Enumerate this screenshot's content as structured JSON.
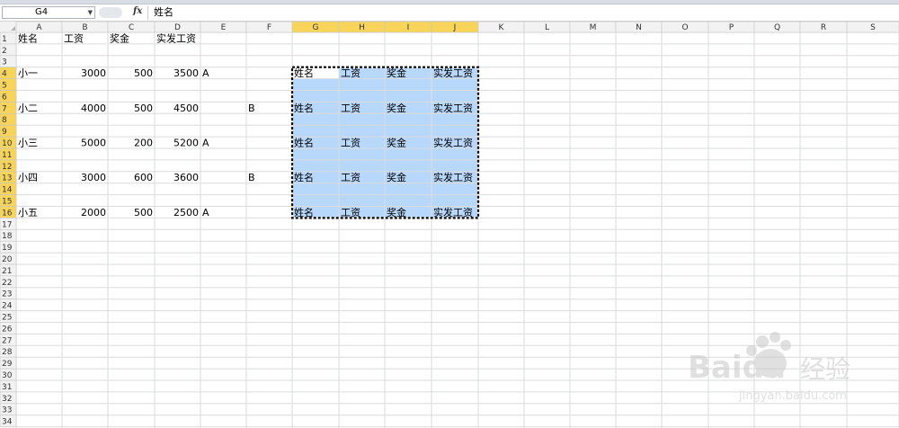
{
  "formula_bar": {
    "name_box": "G4",
    "fx_label": "fx",
    "content": "姓名"
  },
  "sheet": {
    "columns": [
      "A",
      "B",
      "C",
      "D",
      "E",
      "F",
      "G",
      "H",
      "I",
      "J",
      "K",
      "L",
      "M",
      "N",
      "O",
      "P",
      "Q",
      "R",
      "S"
    ],
    "rows": [
      "1",
      "2",
      "3",
      "4",
      "5",
      "6",
      "7",
      "8",
      "9",
      "10",
      "11",
      "12",
      "13",
      "14",
      "15",
      "16",
      "17",
      "18",
      "19",
      "20",
      "21",
      "22",
      "23",
      "24",
      "25",
      "26",
      "27",
      "28",
      "29",
      "30",
      "31",
      "32",
      "33",
      "34"
    ],
    "selected_columns": [
      "G",
      "H",
      "I",
      "J"
    ],
    "selected_rows": [
      "4",
      "5",
      "6",
      "7",
      "8",
      "9",
      "10",
      "11",
      "12",
      "13",
      "14",
      "15",
      "16"
    ],
    "active_cell": "G4",
    "header_color": "#f2f2f2",
    "selected_header_color": "#f8d45a",
    "selection_fill": "#b7d7fb",
    "cells": [
      {
        "ref": "A1",
        "text": "姓名"
      },
      {
        "ref": "B1",
        "text": "工资"
      },
      {
        "ref": "C1",
        "text": "奖金"
      },
      {
        "ref": "D1",
        "text": "实发工资"
      },
      {
        "ref": "A4",
        "text": "小一"
      },
      {
        "ref": "B4",
        "text": "3000"
      },
      {
        "ref": "C4",
        "text": "500"
      },
      {
        "ref": "D4",
        "text": "3500"
      },
      {
        "ref": "E4",
        "text": "A"
      },
      {
        "ref": "G4",
        "text": "姓名"
      },
      {
        "ref": "H4",
        "text": "工资"
      },
      {
        "ref": "I4",
        "text": "奖金"
      },
      {
        "ref": "J4",
        "text": "实发工资"
      },
      {
        "ref": "A7",
        "text": "小二"
      },
      {
        "ref": "B7",
        "text": "4000"
      },
      {
        "ref": "C7",
        "text": "500"
      },
      {
        "ref": "D7",
        "text": "4500"
      },
      {
        "ref": "F7",
        "text": "B"
      },
      {
        "ref": "G7",
        "text": "姓名"
      },
      {
        "ref": "H7",
        "text": "工资"
      },
      {
        "ref": "I7",
        "text": "奖金"
      },
      {
        "ref": "J7",
        "text": "实发工资"
      },
      {
        "ref": "A10",
        "text": "小三"
      },
      {
        "ref": "B10",
        "text": "5000"
      },
      {
        "ref": "C10",
        "text": "200"
      },
      {
        "ref": "D10",
        "text": "5200"
      },
      {
        "ref": "E10",
        "text": "A"
      },
      {
        "ref": "G10",
        "text": "姓名"
      },
      {
        "ref": "H10",
        "text": "工资"
      },
      {
        "ref": "I10",
        "text": "奖金"
      },
      {
        "ref": "J10",
        "text": "实发工资"
      },
      {
        "ref": "A13",
        "text": "小四"
      },
      {
        "ref": "B13",
        "text": "3000"
      },
      {
        "ref": "C13",
        "text": "600"
      },
      {
        "ref": "D13",
        "text": "3600"
      },
      {
        "ref": "F13",
        "text": "B"
      },
      {
        "ref": "G13",
        "text": "姓名"
      },
      {
        "ref": "H13",
        "text": "工资"
      },
      {
        "ref": "I13",
        "text": "奖金"
      },
      {
        "ref": "J13",
        "text": "实发工资"
      },
      {
        "ref": "A16",
        "text": "小五"
      },
      {
        "ref": "B16",
        "text": "2000"
      },
      {
        "ref": "C16",
        "text": "500"
      },
      {
        "ref": "D16",
        "text": "2500"
      },
      {
        "ref": "E16",
        "text": "A"
      },
      {
        "ref": "G16",
        "text": "姓名"
      },
      {
        "ref": "H16",
        "text": "工资"
      },
      {
        "ref": "I16",
        "text": "奖金"
      },
      {
        "ref": "J16",
        "text": "实发工资"
      }
    ],
    "right_aligned": [
      "B4",
      "C4",
      "D4",
      "B7",
      "C7",
      "D7",
      "B10",
      "C10",
      "D10",
      "B13",
      "C13",
      "D13",
      "B16",
      "C16",
      "D16"
    ]
  },
  "watermark": {
    "brand": "Baidu",
    "suffix": "经验",
    "url": "jingyan.baidu.com"
  }
}
